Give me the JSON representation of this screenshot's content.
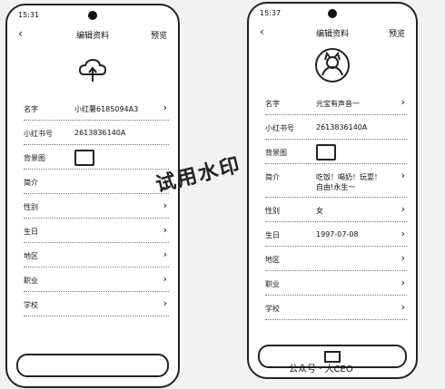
{
  "left": {
    "status": {
      "time": "15:31",
      "right": " "
    },
    "title": "编辑资料",
    "action": "预览",
    "rows": [
      {
        "label": "名字",
        "value": "小红薯6185094A3",
        "arrow": "›"
      },
      {
        "label": "小红书号",
        "value": "2613836140A",
        "arrow": ""
      },
      {
        "label": "背景图",
        "value": "",
        "arrow": ""
      },
      {
        "label": "简介",
        "value": "",
        "arrow": "›"
      },
      {
        "label": "性别",
        "value": "",
        "arrow": "›"
      },
      {
        "label": "生日",
        "value": "",
        "arrow": "›"
      },
      {
        "label": "地区",
        "value": "",
        "arrow": "›"
      },
      {
        "label": "职业",
        "value": "",
        "arrow": "›"
      },
      {
        "label": "学校",
        "value": "",
        "arrow": "›"
      }
    ]
  },
  "right": {
    "status": {
      "time": "15:37",
      "right": " "
    },
    "title": "编辑资料",
    "action": "预览",
    "rows": [
      {
        "label": "名字",
        "value": "元宝有声音一",
        "arrow": "›"
      },
      {
        "label": "小红书号",
        "value": "2613836140A",
        "arrow": ""
      },
      {
        "label": "背景图",
        "value": "",
        "arrow": ""
      },
      {
        "label": "简介",
        "value": "吃饭！喝奶！玩耍！\n自由!永生一",
        "arrow": "›"
      },
      {
        "label": "性别",
        "value": "女",
        "arrow": "›"
      },
      {
        "label": "生日",
        "value": "1997-07-08",
        "arrow": "›"
      },
      {
        "label": "地区",
        "value": "",
        "arrow": "›"
      },
      {
        "label": "职业",
        "value": "",
        "arrow": "›"
      },
      {
        "label": "学校",
        "value": "",
        "arrow": "›"
      }
    ]
  },
  "watermark": "试用水印",
  "footer": "公众号 · 大CEO"
}
